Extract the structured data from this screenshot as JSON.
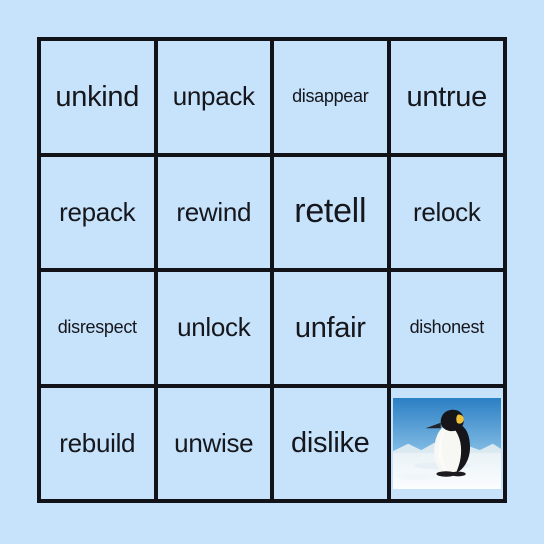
{
  "card": {
    "type": "bingo-card",
    "grid": {
      "rows": 4,
      "columns": 4
    },
    "colors": {
      "background": "#c7e2fb",
      "cell_fill": "#c7e2fb",
      "grid_line": "#111319",
      "text": "#15171c"
    },
    "cells": [
      {
        "text": "unkind",
        "size": "lg",
        "kind": "word"
      },
      {
        "text": "unpack",
        "size": "md",
        "kind": "word"
      },
      {
        "text": "disappear",
        "size": "sm",
        "kind": "word"
      },
      {
        "text": "untrue",
        "size": "lg",
        "kind": "word"
      },
      {
        "text": "repack",
        "size": "md",
        "kind": "word"
      },
      {
        "text": "rewind",
        "size": "md",
        "kind": "word"
      },
      {
        "text": "retell",
        "size": "xl",
        "kind": "word"
      },
      {
        "text": "relock",
        "size": "md",
        "kind": "word"
      },
      {
        "text": "disrespect",
        "size": "sm",
        "kind": "word"
      },
      {
        "text": "unlock",
        "size": "md",
        "kind": "word"
      },
      {
        "text": "unfair",
        "size": "lg",
        "kind": "word"
      },
      {
        "text": "dishonest",
        "size": "sm",
        "kind": "word"
      },
      {
        "text": "rebuild",
        "size": "md",
        "kind": "word"
      },
      {
        "text": "unwise",
        "size": "md",
        "kind": "word"
      },
      {
        "text": "dislike",
        "size": "lg",
        "kind": "word"
      },
      {
        "text": "",
        "size": "md",
        "kind": "image",
        "image_name": "penguin-photo"
      }
    ]
  }
}
